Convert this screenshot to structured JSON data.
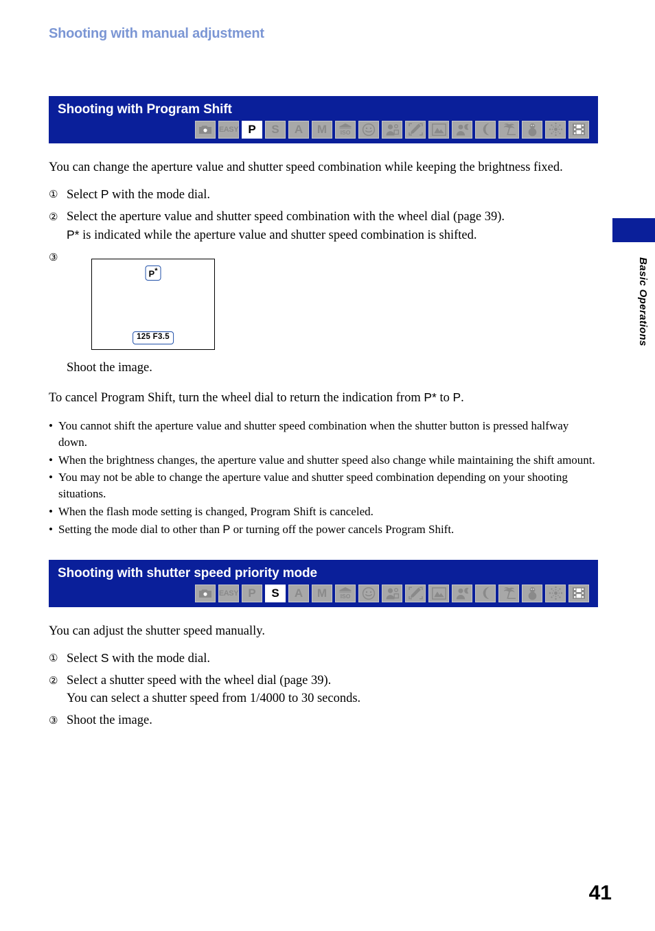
{
  "running_head": "Shooting with manual adjustment",
  "side_tab": {
    "label": "Basic Operations",
    "swatch_color": "#0a1f9a"
  },
  "colors": {
    "section_blue": "#0a1f9a",
    "running_head_blue": "#7b96d4",
    "mode_cell_gray": "#a8a8a8",
    "osd_border_blue": "#1f4fa8"
  },
  "mode_dial_icons": [
    {
      "name": "camera-auto",
      "type": "icon",
      "icon": "camera-icon"
    },
    {
      "name": "easy",
      "type": "text",
      "label": "EASY"
    },
    {
      "name": "program-auto",
      "type": "text",
      "label": "P"
    },
    {
      "name": "shutter-priority",
      "type": "text",
      "label": "S"
    },
    {
      "name": "aperture-priority",
      "type": "text",
      "label": "A"
    },
    {
      "name": "manual",
      "type": "text",
      "label": "M"
    },
    {
      "name": "high-sensitivity",
      "type": "icon",
      "icon": "iso-icon",
      "label": "ISO"
    },
    {
      "name": "smile-shutter",
      "type": "icon",
      "icon": "smile-icon"
    },
    {
      "name": "soft-snap",
      "type": "icon",
      "icon": "soft-snap-icon"
    },
    {
      "name": "anti-blur",
      "type": "icon",
      "icon": "anti-blur-icon"
    },
    {
      "name": "landscape",
      "type": "icon",
      "icon": "landscape-icon"
    },
    {
      "name": "twilight-portrait",
      "type": "icon",
      "icon": "twilight-portrait-icon"
    },
    {
      "name": "twilight",
      "type": "icon",
      "icon": "moon-icon"
    },
    {
      "name": "beach",
      "type": "icon",
      "icon": "palm-tree-icon"
    },
    {
      "name": "snow",
      "type": "icon",
      "icon": "snowman-icon"
    },
    {
      "name": "fireworks",
      "type": "icon",
      "icon": "fireworks-icon"
    },
    {
      "name": "movie",
      "type": "icon",
      "icon": "film-strip-icon"
    }
  ],
  "section1": {
    "title": "Shooting with Program Shift",
    "selected_mode": "P",
    "intro": "You can change the aperture value and shutter speed combination while keeping the brightness fixed.",
    "steps": [
      {
        "num": "①",
        "text_before": "Select ",
        "mode": "P",
        "text_after": " with the mode dial.",
        "sub": ""
      },
      {
        "num": "②",
        "text_before": "Select the aperture value and shutter speed combination with the wheel dial (page 39).",
        "mode": "",
        "text_after": "",
        "sub": "P* is indicated while the aperture value and shutter speed combination is shifted."
      },
      {
        "num": "③",
        "text_before": "Shoot the image.",
        "mode": "",
        "text_after": "",
        "sub": ""
      }
    ],
    "lcd": {
      "mode_indicator_base": "P",
      "mode_indicator_sup": "*",
      "exposure": "125  F3.5"
    },
    "cancel_line_a": "To cancel Program Shift, turn the wheel dial to return the indication from ",
    "cancel_mode_1": "P*",
    "cancel_line_b": " to ",
    "cancel_mode_2": "P",
    "cancel_line_c": ".",
    "notes": [
      {
        "text": "You cannot shift the aperture value and shutter speed combination when the shutter button is pressed halfway down."
      },
      {
        "text": "When the brightness changes, the aperture value and shutter speed also change while maintaining the shift amount."
      },
      {
        "text": "You may not be able to change the aperture value and shutter speed combination depending on your shooting situations."
      },
      {
        "text": "When the flash mode setting is changed, Program Shift is canceled."
      },
      {
        "text_before": "Setting the mode dial to other than ",
        "mode": "P",
        "text_after": " or turning off the power cancels Program Shift."
      }
    ]
  },
  "section2": {
    "title": "Shooting with shutter speed priority mode",
    "selected_mode": "S",
    "intro": "You can adjust the shutter speed manually.",
    "steps": [
      {
        "num": "①",
        "text_before": "Select ",
        "mode": "S",
        "text_after": " with the mode dial.",
        "sub": ""
      },
      {
        "num": "②",
        "text_before": "Select a shutter speed with the wheel dial (page 39).",
        "mode": "",
        "text_after": "",
        "sub": "You can select a shutter speed from 1/4000 to 30 seconds."
      },
      {
        "num": "③",
        "text_before": "Shoot the image.",
        "mode": "",
        "text_after": "",
        "sub": ""
      }
    ]
  },
  "page_number": "41"
}
